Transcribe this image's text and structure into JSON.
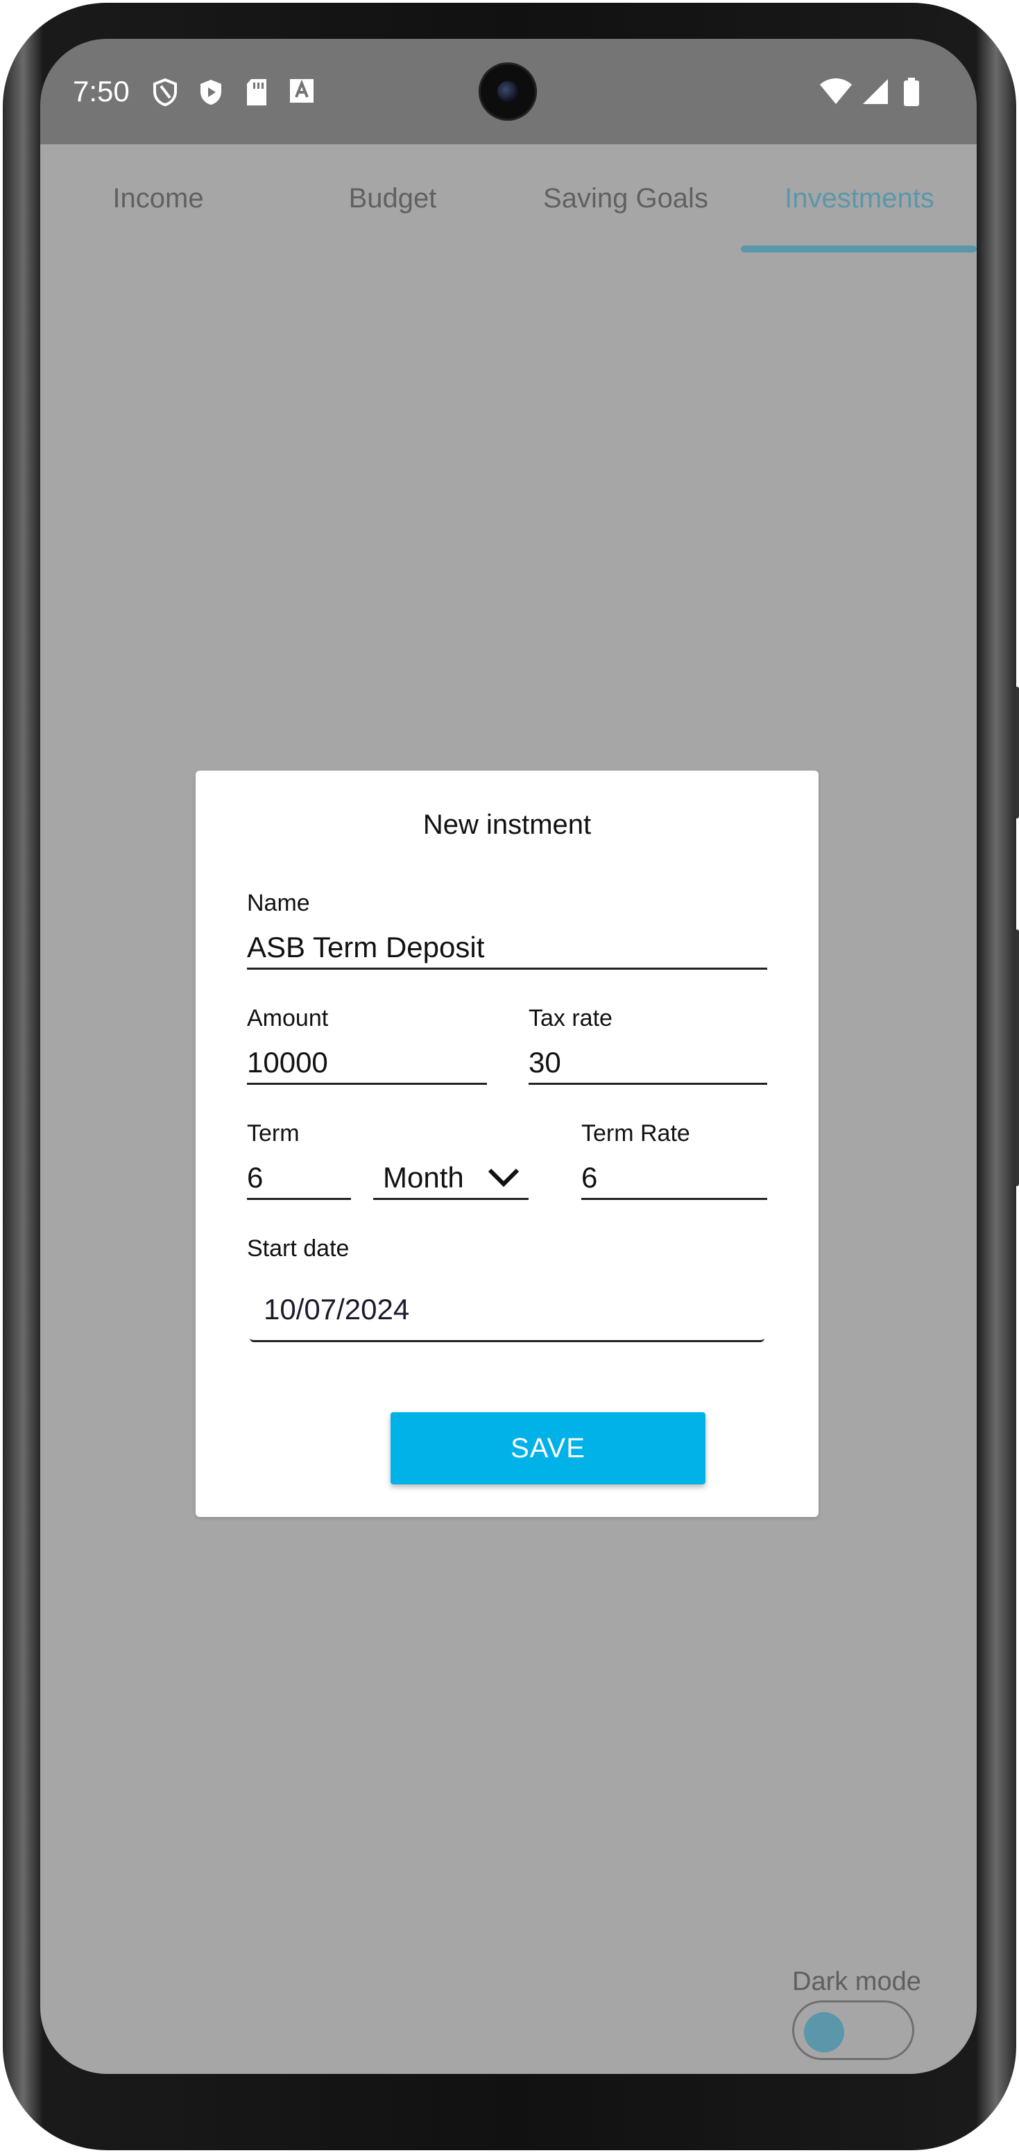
{
  "status_bar": {
    "time": "7:50",
    "left_icons": [
      "shield-outline-icon",
      "play-shield-icon",
      "sd-card-icon",
      "font-a-icon"
    ],
    "right_icons": [
      "wifi-icon",
      "signal-icon",
      "battery-icon"
    ]
  },
  "tabs": [
    {
      "label": "Income",
      "active": false
    },
    {
      "label": "Budget",
      "active": false
    },
    {
      "label": "Saving Goals",
      "active": false
    },
    {
      "label": "Investments",
      "active": true
    }
  ],
  "dialog": {
    "title": "New instment",
    "name": {
      "label": "Name",
      "value": "ASB Term Deposit"
    },
    "amount": {
      "label": "Amount",
      "value": "10000"
    },
    "tax_rate": {
      "label": "Tax rate",
      "value": "30"
    },
    "term": {
      "label": "Term",
      "value": "6"
    },
    "term_unit": {
      "value": "Month"
    },
    "term_rate": {
      "label": "Term Rate",
      "value": "6"
    },
    "start_date": {
      "label": "Start date",
      "value": "10/07/2024"
    },
    "save_label": "SAVE"
  },
  "dark_mode": {
    "label": "Dark mode",
    "enabled": false
  },
  "colors": {
    "accent": "#5a97aa",
    "save_button": "#00b2e8",
    "overlay": "#a6a6a6",
    "status_bar": "#757575"
  }
}
